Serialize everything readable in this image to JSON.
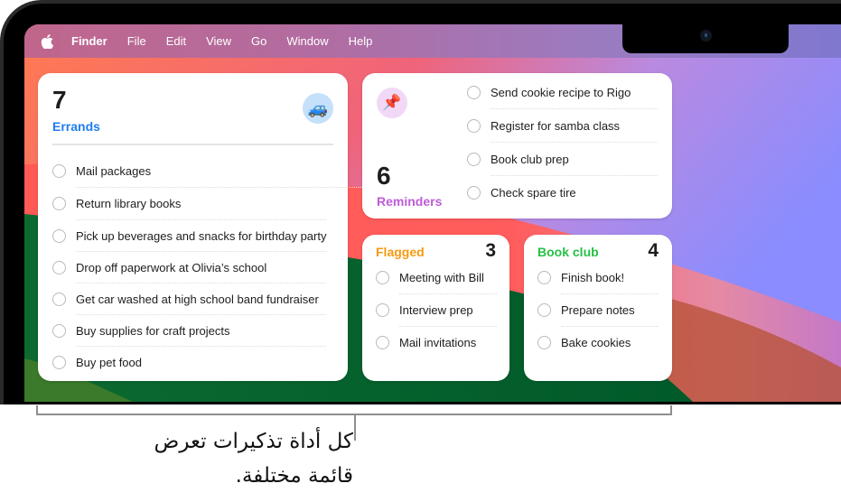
{
  "menubar": {
    "apple_icon": "apple-logo",
    "items": [
      "Finder",
      "File",
      "Edit",
      "View",
      "Go",
      "Window",
      "Help"
    ]
  },
  "widgets": {
    "errands": {
      "count": "7",
      "title": "Errands",
      "color": "#1f7cf0",
      "icon": "🚙",
      "items": [
        "Mail packages",
        "Return library books",
        "Pick up beverages and snacks for birthday party",
        "Drop off paperwork at Olivia’s school",
        "Get car washed at high school band fundraiser",
        "Buy supplies for craft projects",
        "Buy pet food"
      ]
    },
    "reminders": {
      "count": "6",
      "title": "Reminders",
      "color": "#bf5bd9",
      "icon": "📌",
      "items": [
        "Send cookie recipe to Rigo",
        "Register for samba class",
        "Book club prep",
        "Check spare tire"
      ]
    },
    "flagged": {
      "count": "3",
      "title": "Flagged",
      "color": "#f59a10",
      "items": [
        "Meeting with Bill",
        "Interview prep",
        "Mail invitations"
      ]
    },
    "bookclub": {
      "count": "4",
      "title": "Book club",
      "color": "#27c046",
      "items": [
        "Finish book!",
        "Prepare notes",
        "Bake cookies"
      ]
    }
  },
  "caption": {
    "line1": "كل أداة تذكيرات تعرض",
    "line2": "قائمة مختلفة."
  }
}
